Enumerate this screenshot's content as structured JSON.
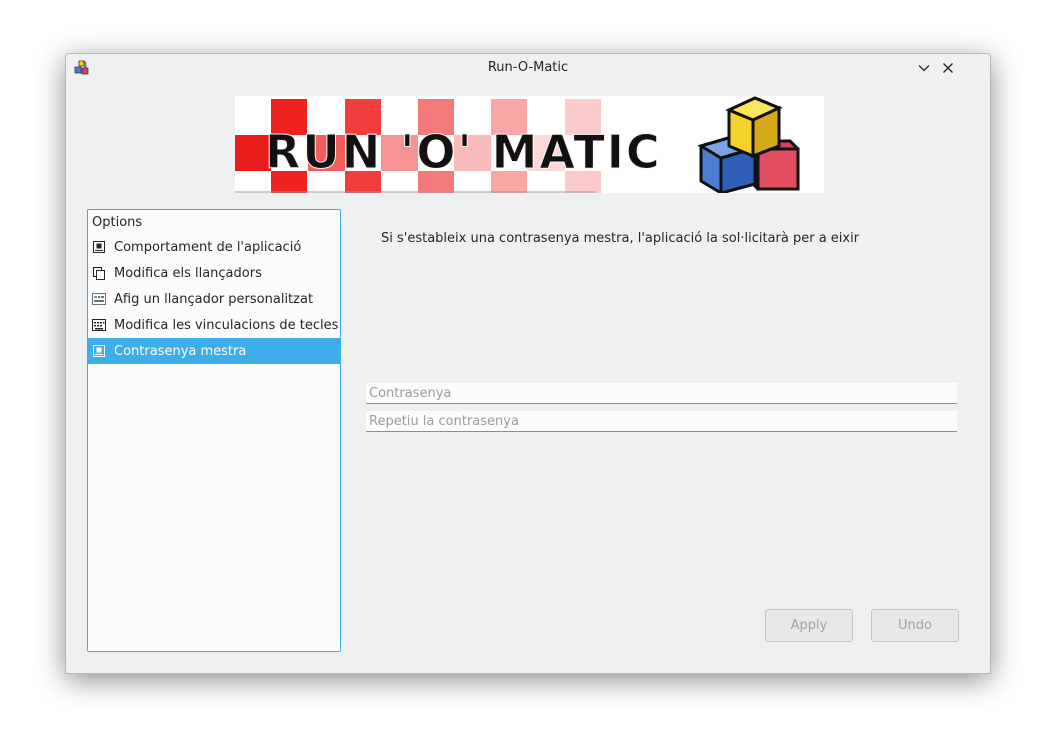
{
  "window": {
    "title": "Run-O-Matic"
  },
  "banner": {
    "logo_text": "RUN 'O' MATIC"
  },
  "options": {
    "header": "Options",
    "items": [
      {
        "label": "Comportament de l'aplicació",
        "icon": "app-behavior-icon"
      },
      {
        "label": "Modifica els llançadors",
        "icon": "copy-icon"
      },
      {
        "label": "Afig un llançador personalitzat",
        "icon": "custom-launcher-icon"
      },
      {
        "label": "Modifica les vinculacions de tecles",
        "icon": "keyboard-icon"
      },
      {
        "label": "Contrasenya mestra",
        "icon": "password-icon",
        "selected": true
      }
    ]
  },
  "main": {
    "description": "Si s'estableix una contrasenya mestra, l'aplicació la sol·licitarà per a eixir",
    "password_placeholder": "Contrasenya",
    "repeat_placeholder": "Repetiu la contrasenya",
    "password_value": "",
    "repeat_value": ""
  },
  "buttons": {
    "apply": "Apply",
    "undo": "Undo"
  },
  "colors": {
    "accent": "#3daee9",
    "window_bg": "#eff0f1"
  }
}
